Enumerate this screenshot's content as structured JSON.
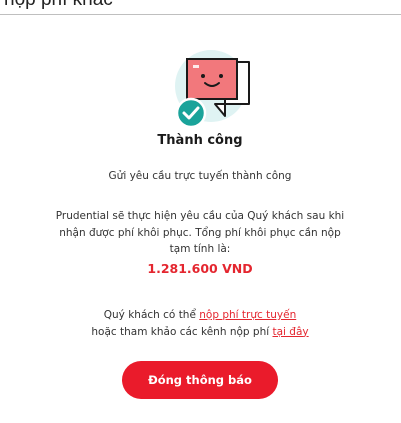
{
  "background": {
    "title": "nộp phí khác"
  },
  "dialog": {
    "icon": "success-chat-illustration",
    "title": "Thành công",
    "subtitle": "Gửi yêu cầu trực tuyến thành công",
    "message_line1": "Prudential sẽ thực hiện yêu cầu của Quý khách sau khi",
    "message_line2": "nhận được phí khôi phục. Tổng phí khôi phục cần nộp",
    "message_line3": "tạm tính là:",
    "amount": "1.281.600 VND",
    "info_prefix": "Quý khách có thể ",
    "online_payment_link": "nộp phí trực tuyến",
    "info_line2_prefix": "hoặc tham khảo các kênh nộp phí ",
    "here_link": "tại đây",
    "close_button": "Đóng thông báo"
  },
  "colors": {
    "accent": "#ea1b2b",
    "link": "#e4262f",
    "check_badge": "#1aa39a",
    "chat_bubble": "#f2787c",
    "illustration_bg": "#dff3f3"
  }
}
